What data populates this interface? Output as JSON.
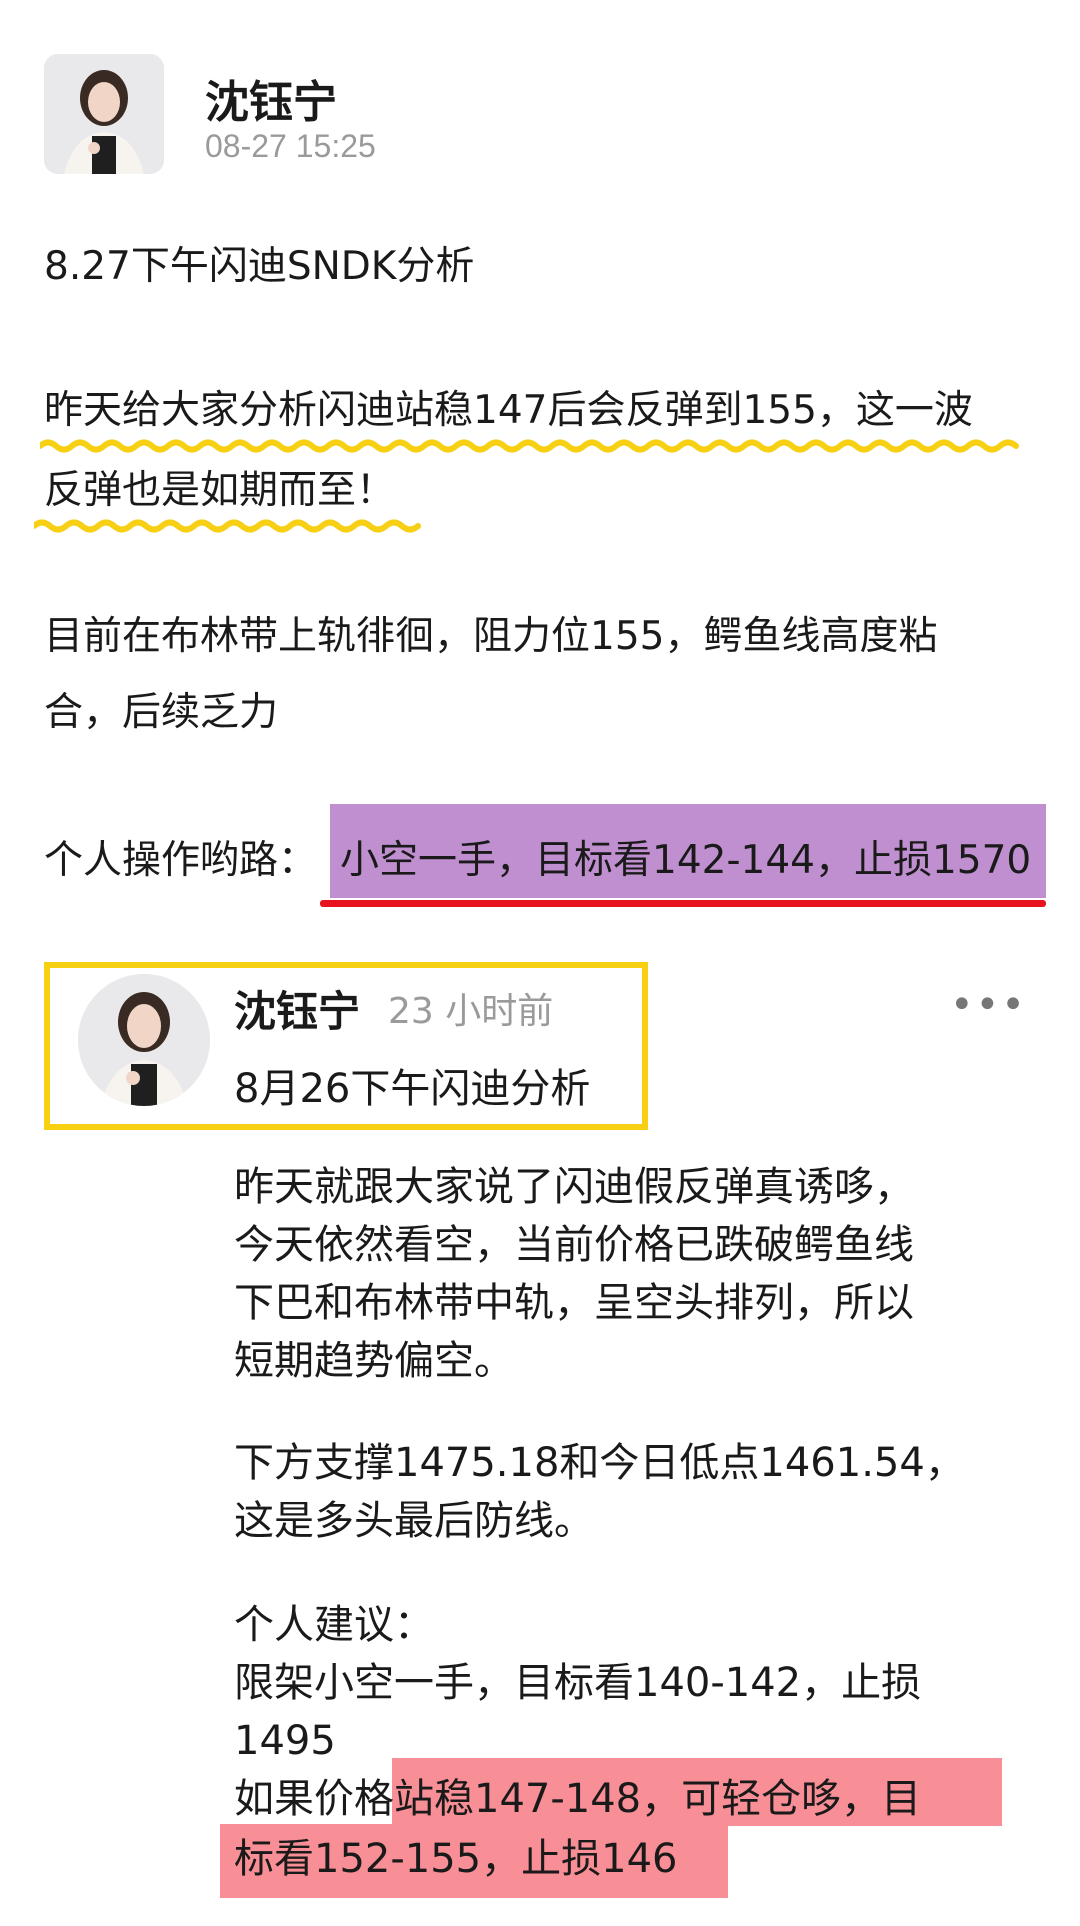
{
  "post": {
    "author": "沈钰宁",
    "timestamp": "08-27 15:25",
    "title": "8.27下午闪迪SNDK分析",
    "p1_line1": "昨天给大家分析闪迪站稳147后会反弹到155，这一波",
    "p1_line2": "反弹也是如期而至！",
    "p2_line1": "目前在布林带上轨徘徊，阻力位155，鳄鱼线高度粘",
    "p2_line2": "合，后续乏力",
    "p3_label": "个人操作哟路：",
    "p3_highlight": "小空一手，目标看142-144，止损1570"
  },
  "quoted": {
    "author": "沈钰宁",
    "time": "23 小时前",
    "title": "8月26下午闪迪分析",
    "more": "•••",
    "lines": [
      "昨天就跟大家说了闪迪假反弹真诱哆，",
      "今天依然看空，当前价格已跌破鳄鱼线",
      "下巴和布林带中轨，呈空头排列，所以",
      "短期趋势偏空。"
    ],
    "support_lines": [
      "下方支撑1475.18和今日低点1461.54，",
      "这是多头最后防线。"
    ],
    "advice_label": "个人建议：",
    "advice_line1": "限架小空一手，目标看140-142，止损",
    "advice_line2": "1495",
    "advice_line3_plain": "如果价格",
    "advice_line3_hl": "站稳147-148，可轻仓哆，目",
    "advice_line4_hl": "标看152-155，止损146"
  },
  "colors": {
    "wavy_underline": "#f7cf13",
    "purple_highlight": "#c08fd0",
    "red_underline": "#e8121c",
    "card_border": "#f7cf13",
    "pink_highlight": "#f88f96"
  }
}
